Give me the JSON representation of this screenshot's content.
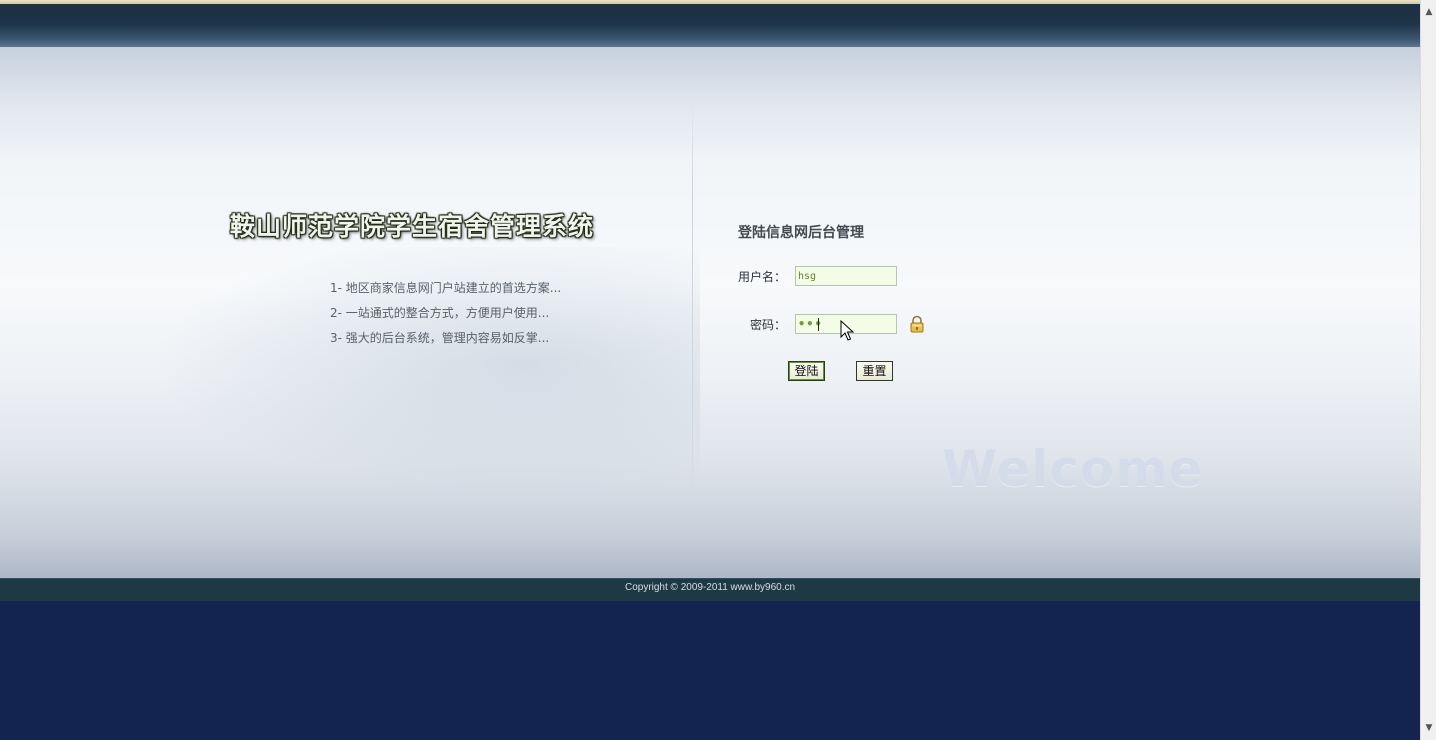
{
  "page": {
    "system_title": "鞍山师范学院学生宿舍管理系统",
    "features": [
      "1- 地区商家信息网门户站建立的首选方案...",
      "2- 一站通式的整合方式，方便用户使用...",
      "3- 强大的后台系统，管理内容易如反掌..."
    ]
  },
  "login": {
    "heading": "登陆信息网后台管理",
    "username_label": "用户名：",
    "username_value": "hsg",
    "password_label": "密码：",
    "password_masked": "•••",
    "login_button": "登陆",
    "reset_button": "重置",
    "lock_icon": "lock-icon"
  },
  "decor": {
    "welcome_text": "Welcome"
  },
  "footer": {
    "copyright": "Copyright © 2009-2011 www.by960.cn"
  },
  "colors": {
    "topbar": "#1c3143",
    "footer_bar": "#1d3a44",
    "page_bottom": "#12244f",
    "input_bg": "#f4fbe7"
  }
}
